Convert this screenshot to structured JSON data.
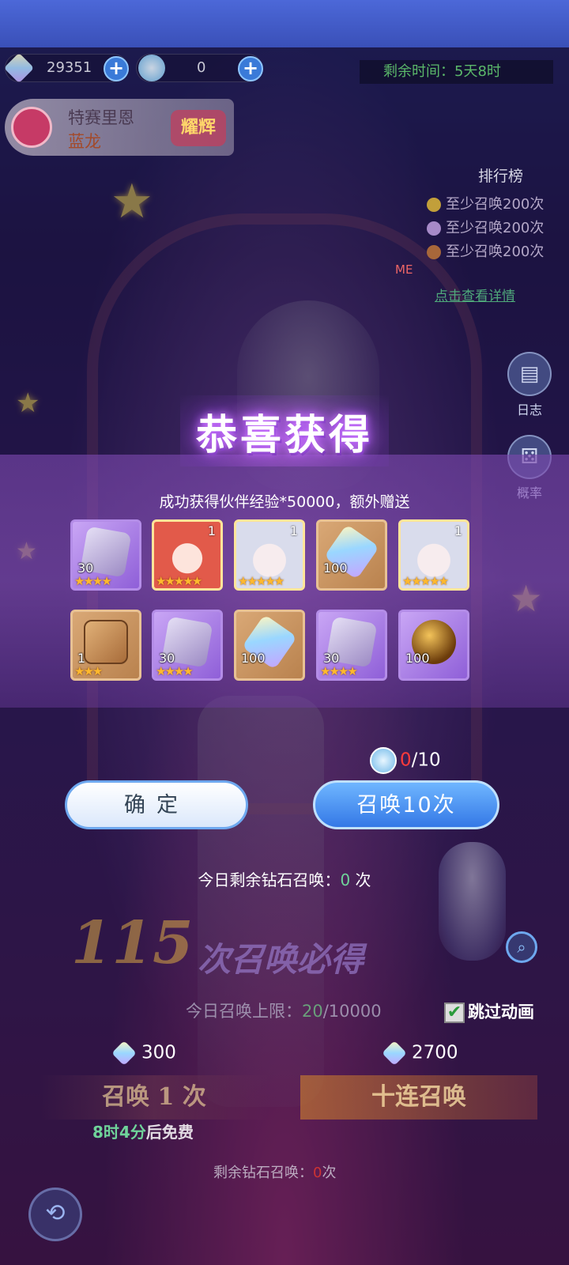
{
  "resources": [
    {
      "value": "29351",
      "icon": "diamond-icon"
    },
    {
      "value": "0",
      "icon": "summon-ticket-icon"
    }
  ],
  "timer": {
    "label": "剩余时间：",
    "value": "5天8时"
  },
  "event": {
    "name": "特赛里恩",
    "subtitle": "蓝龙",
    "tag": "耀辉"
  },
  "ranking": {
    "title": "排行榜",
    "rows": [
      "至少召唤200次",
      "至少召唤200次",
      "至少召唤200次"
    ],
    "me": "ME",
    "link": "点击查看详情"
  },
  "side": {
    "log": "日志",
    "probability": "概率"
  },
  "modal": {
    "title": "恭喜获得",
    "subtitle": "成功获得伙伴经验*50000，额外赠送",
    "items": [
      {
        "type": "purple-stone",
        "count": "30",
        "stars": "★★★★"
      },
      {
        "type": "red-hair-partner",
        "count": "",
        "level": "1",
        "stars": "★★★★★"
      },
      {
        "type": "white-hair-partner",
        "count": "",
        "level": "1",
        "stars": "★★★★★"
      },
      {
        "type": "crystal",
        "count": "100",
        "stars": ""
      },
      {
        "type": "white-hair-partner",
        "count": "",
        "level": "1",
        "stars": "★★★★★"
      },
      {
        "type": "mystery-box",
        "count": "1",
        "stars": "★★★"
      },
      {
        "type": "purple-stone",
        "count": "30",
        "stars": "★★★★"
      },
      {
        "type": "crystal",
        "count": "100",
        "stars": ""
      },
      {
        "type": "purple-stone",
        "count": "30",
        "stars": "★★★★"
      },
      {
        "type": "golden-egg",
        "count": "100",
        "stars": ""
      }
    ],
    "ticket_current": "0",
    "ticket_total": "/10",
    "confirm_label": "确定",
    "summon10_label": "召唤10次",
    "remaining_prefix": "今日剩余钻石召唤：",
    "remaining_value": "0",
    "remaining_suffix": " 次"
  },
  "background": {
    "guarantee_count": "115",
    "guarantee_text": "次召唤必得",
    "limit_label": "今日召唤上限：",
    "limit_current": "20",
    "limit_total": "/10000",
    "skip_label": "跳过动画",
    "cost_one": "300",
    "cost_ten": "2700",
    "summon_one": "召唤 1 次",
    "summon_ten": "十连召唤",
    "free_time": "8时4分",
    "free_suffix": "后免费",
    "remaining_label": "剩余钻石召唤：",
    "remaining_value": "0",
    "remaining_suffix": "次"
  }
}
